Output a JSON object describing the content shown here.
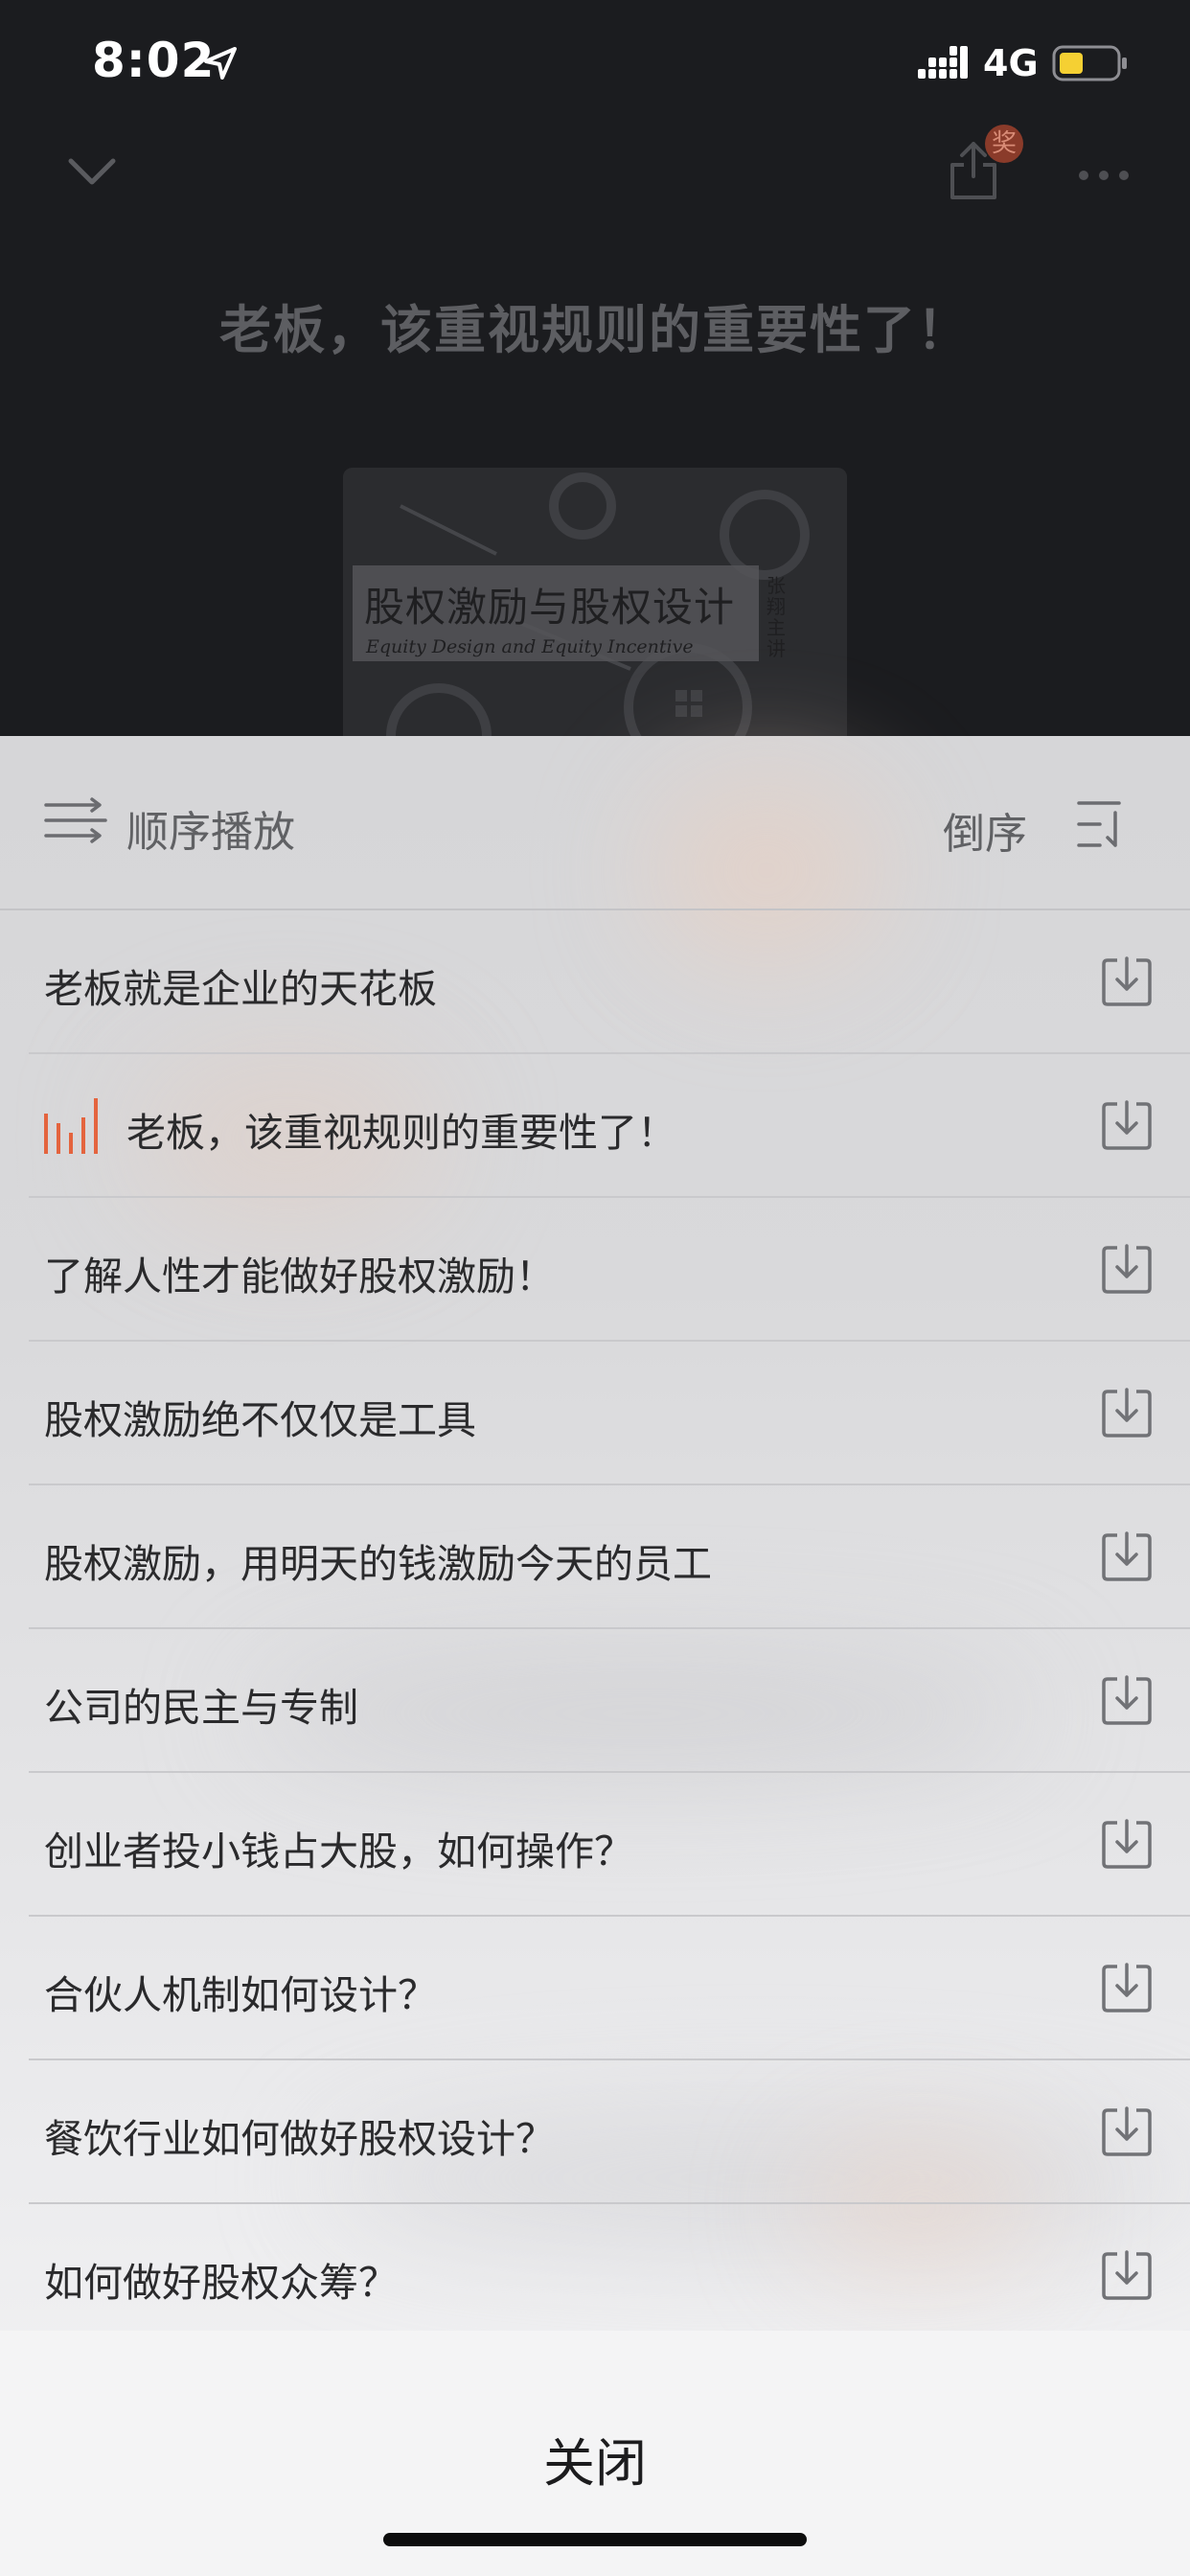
{
  "status_bar": {
    "time": "8:02",
    "network": "4G",
    "icons": [
      "location-arrow-icon",
      "signal-icon",
      "battery-icon"
    ],
    "battery_color": "#f5d033"
  },
  "player": {
    "title": "老板，该重视规则的重要性了！",
    "award_badge": "奖",
    "icons": [
      "chevron-down-icon",
      "share-icon",
      "more-icon"
    ],
    "cover": {
      "title": "股权激励与股权设计",
      "subtitle": "Equity Design and Equity Incentive",
      "author": "张翔主讲"
    }
  },
  "playlist": {
    "order_label": "顺序播放",
    "reverse_label": "倒序",
    "playing_color": "#e4643e",
    "tracks": [
      {
        "label": "老板就是企业的天花板",
        "playing": false
      },
      {
        "label": "老板，该重视规则的重要性了！",
        "playing": true
      },
      {
        "label": "了解人性才能做好股权激励！",
        "playing": false
      },
      {
        "label": "股权激励绝不仅仅是工具",
        "playing": false
      },
      {
        "label": "股权激励，用明天的钱激励今天的员工",
        "playing": false
      },
      {
        "label": "公司的民主与专制",
        "playing": false
      },
      {
        "label": "创业者投小钱占大股，如何操作？",
        "playing": false
      },
      {
        "label": "合伙人机制如何设计？",
        "playing": false
      },
      {
        "label": "餐饮行业如何做好股权设计？",
        "playing": false
      },
      {
        "label": "如何做好股权众筹？",
        "playing": false
      }
    ],
    "close_label": "关闭"
  }
}
